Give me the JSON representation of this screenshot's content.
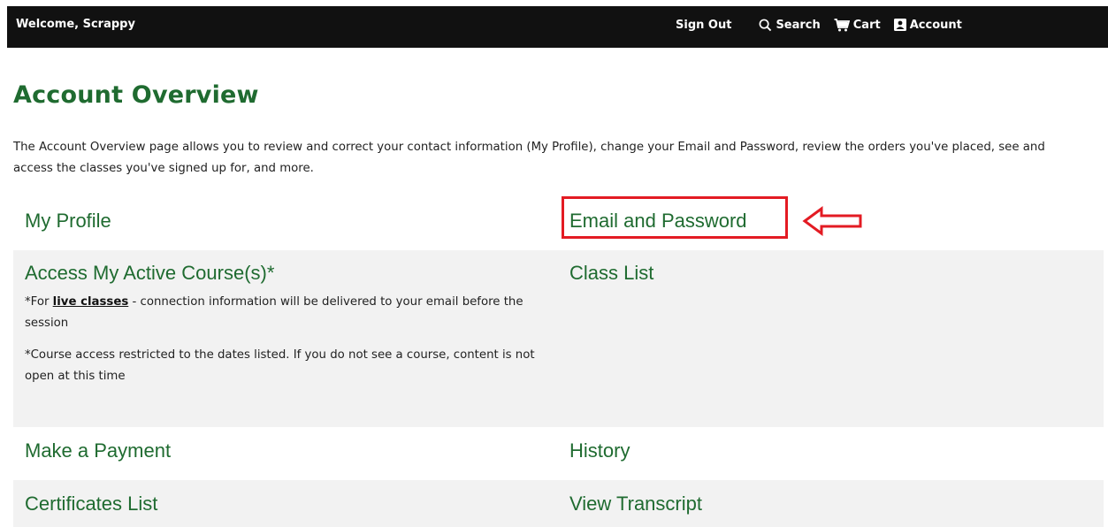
{
  "header": {
    "welcome": "Welcome, Scrappy",
    "sign_out": "Sign Out",
    "search": "Search",
    "cart": "Cart",
    "account": "Account"
  },
  "page": {
    "title": "Account Overview",
    "intro": "The Account Overview page allows you to review and correct your contact information (My Profile), change your Email and Password, review the orders you've placed, see and access the classes you've signed up for, and more."
  },
  "links": {
    "my_profile": "My Profile",
    "email_password": "Email and Password",
    "access_courses": "Access My Active Course(s)*",
    "class_list": "Class List",
    "make_payment": "Make a Payment",
    "history": "History",
    "certificates": "Certificates List",
    "transcript": "View Transcript"
  },
  "notes": {
    "live_prefix": "*For ",
    "live_link": "live classes",
    "live_suffix": " - connection information will be delivered to your email before the session",
    "access_note": "*Course access restricted to the dates listed. If you do not see a course, content is not open at this time"
  },
  "colors": {
    "brand_green": "#1f6b30",
    "header_bg": "#111111",
    "highlight_red": "#e31b23",
    "row_shade": "#f2f2f2"
  }
}
